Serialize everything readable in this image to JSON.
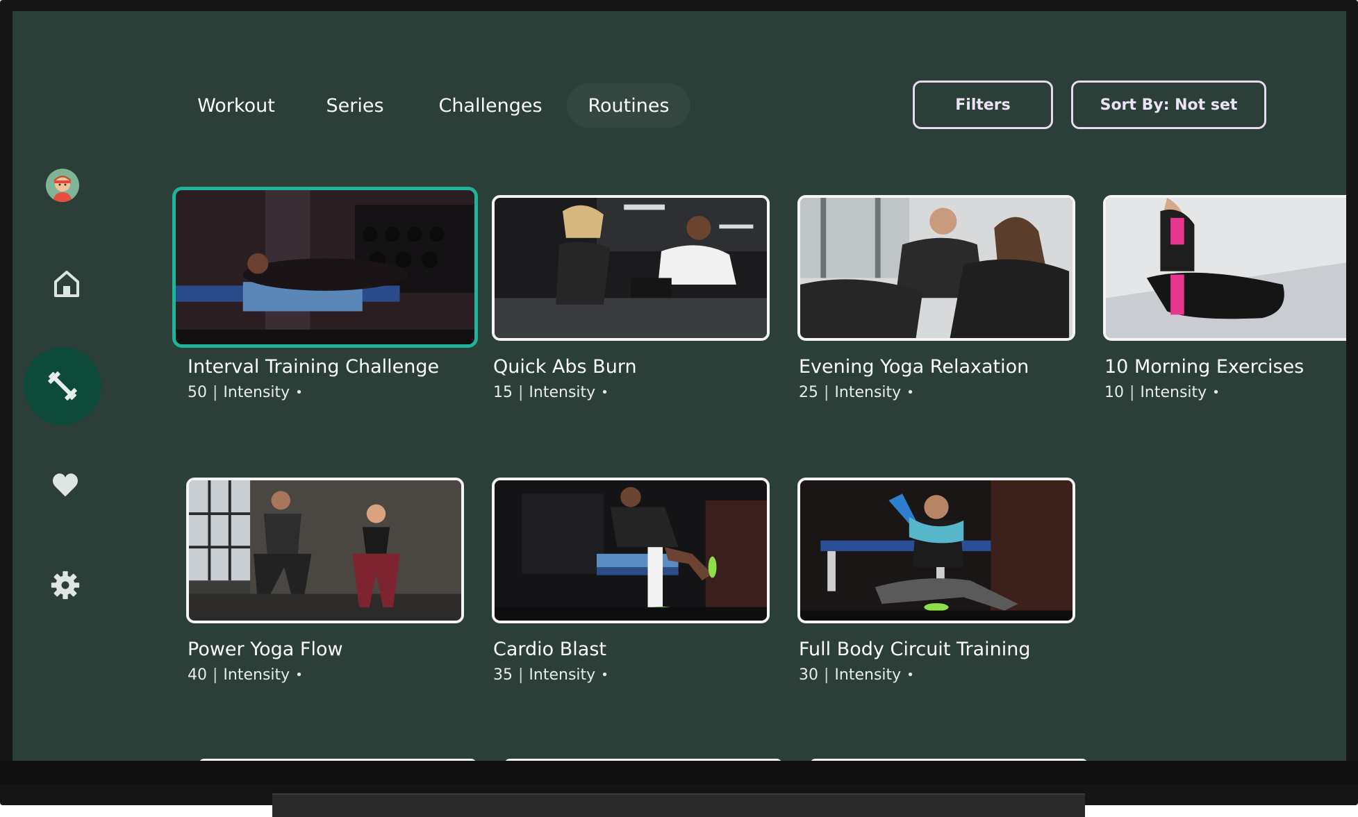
{
  "tabs": [
    {
      "label": "Workout"
    },
    {
      "label": "Series"
    },
    {
      "label": "Challenges"
    },
    {
      "label": "Routines",
      "selected": true
    }
  ],
  "actions": {
    "filters_label": "Filters",
    "sort_label": "Sort By: Not set"
  },
  "side_nav": [
    {
      "icon": "avatar-icon"
    },
    {
      "icon": "home-icon"
    },
    {
      "icon": "dumbbell-icon",
      "selected": true
    },
    {
      "icon": "heart-icon"
    },
    {
      "icon": "gear-icon"
    }
  ],
  "cards": [
    {
      "title": "Interval Training Challenge",
      "count": "50",
      "sep": "|",
      "intensity": "Intensity",
      "dot": "•",
      "focused": true
    },
    {
      "title": "Quick Abs Burn",
      "count": "15",
      "sep": "|",
      "intensity": "Intensity",
      "dot": "•"
    },
    {
      "title": "Evening Yoga Relaxation",
      "count": "25",
      "sep": "|",
      "intensity": "Intensity",
      "dot": "•"
    },
    {
      "title": "10 Morning Exercises",
      "count": "10",
      "sep": "|",
      "intensity": "Intensity",
      "dot": "•"
    },
    {
      "title": "Power Yoga Flow",
      "count": "40",
      "sep": "|",
      "intensity": "Intensity",
      "dot": "•"
    },
    {
      "title": "Cardio Blast",
      "count": "35",
      "sep": "|",
      "intensity": "Intensity",
      "dot": "•"
    },
    {
      "title": "Full Body Circuit Training",
      "count": "30",
      "sep": "|",
      "intensity": "Intensity",
      "dot": "•"
    }
  ],
  "colors": {
    "background": "#2c3e38",
    "focus_ring": "#1fb39a",
    "nav_selected": "#0e4a3a",
    "outline_button": "#e6dcf2"
  }
}
